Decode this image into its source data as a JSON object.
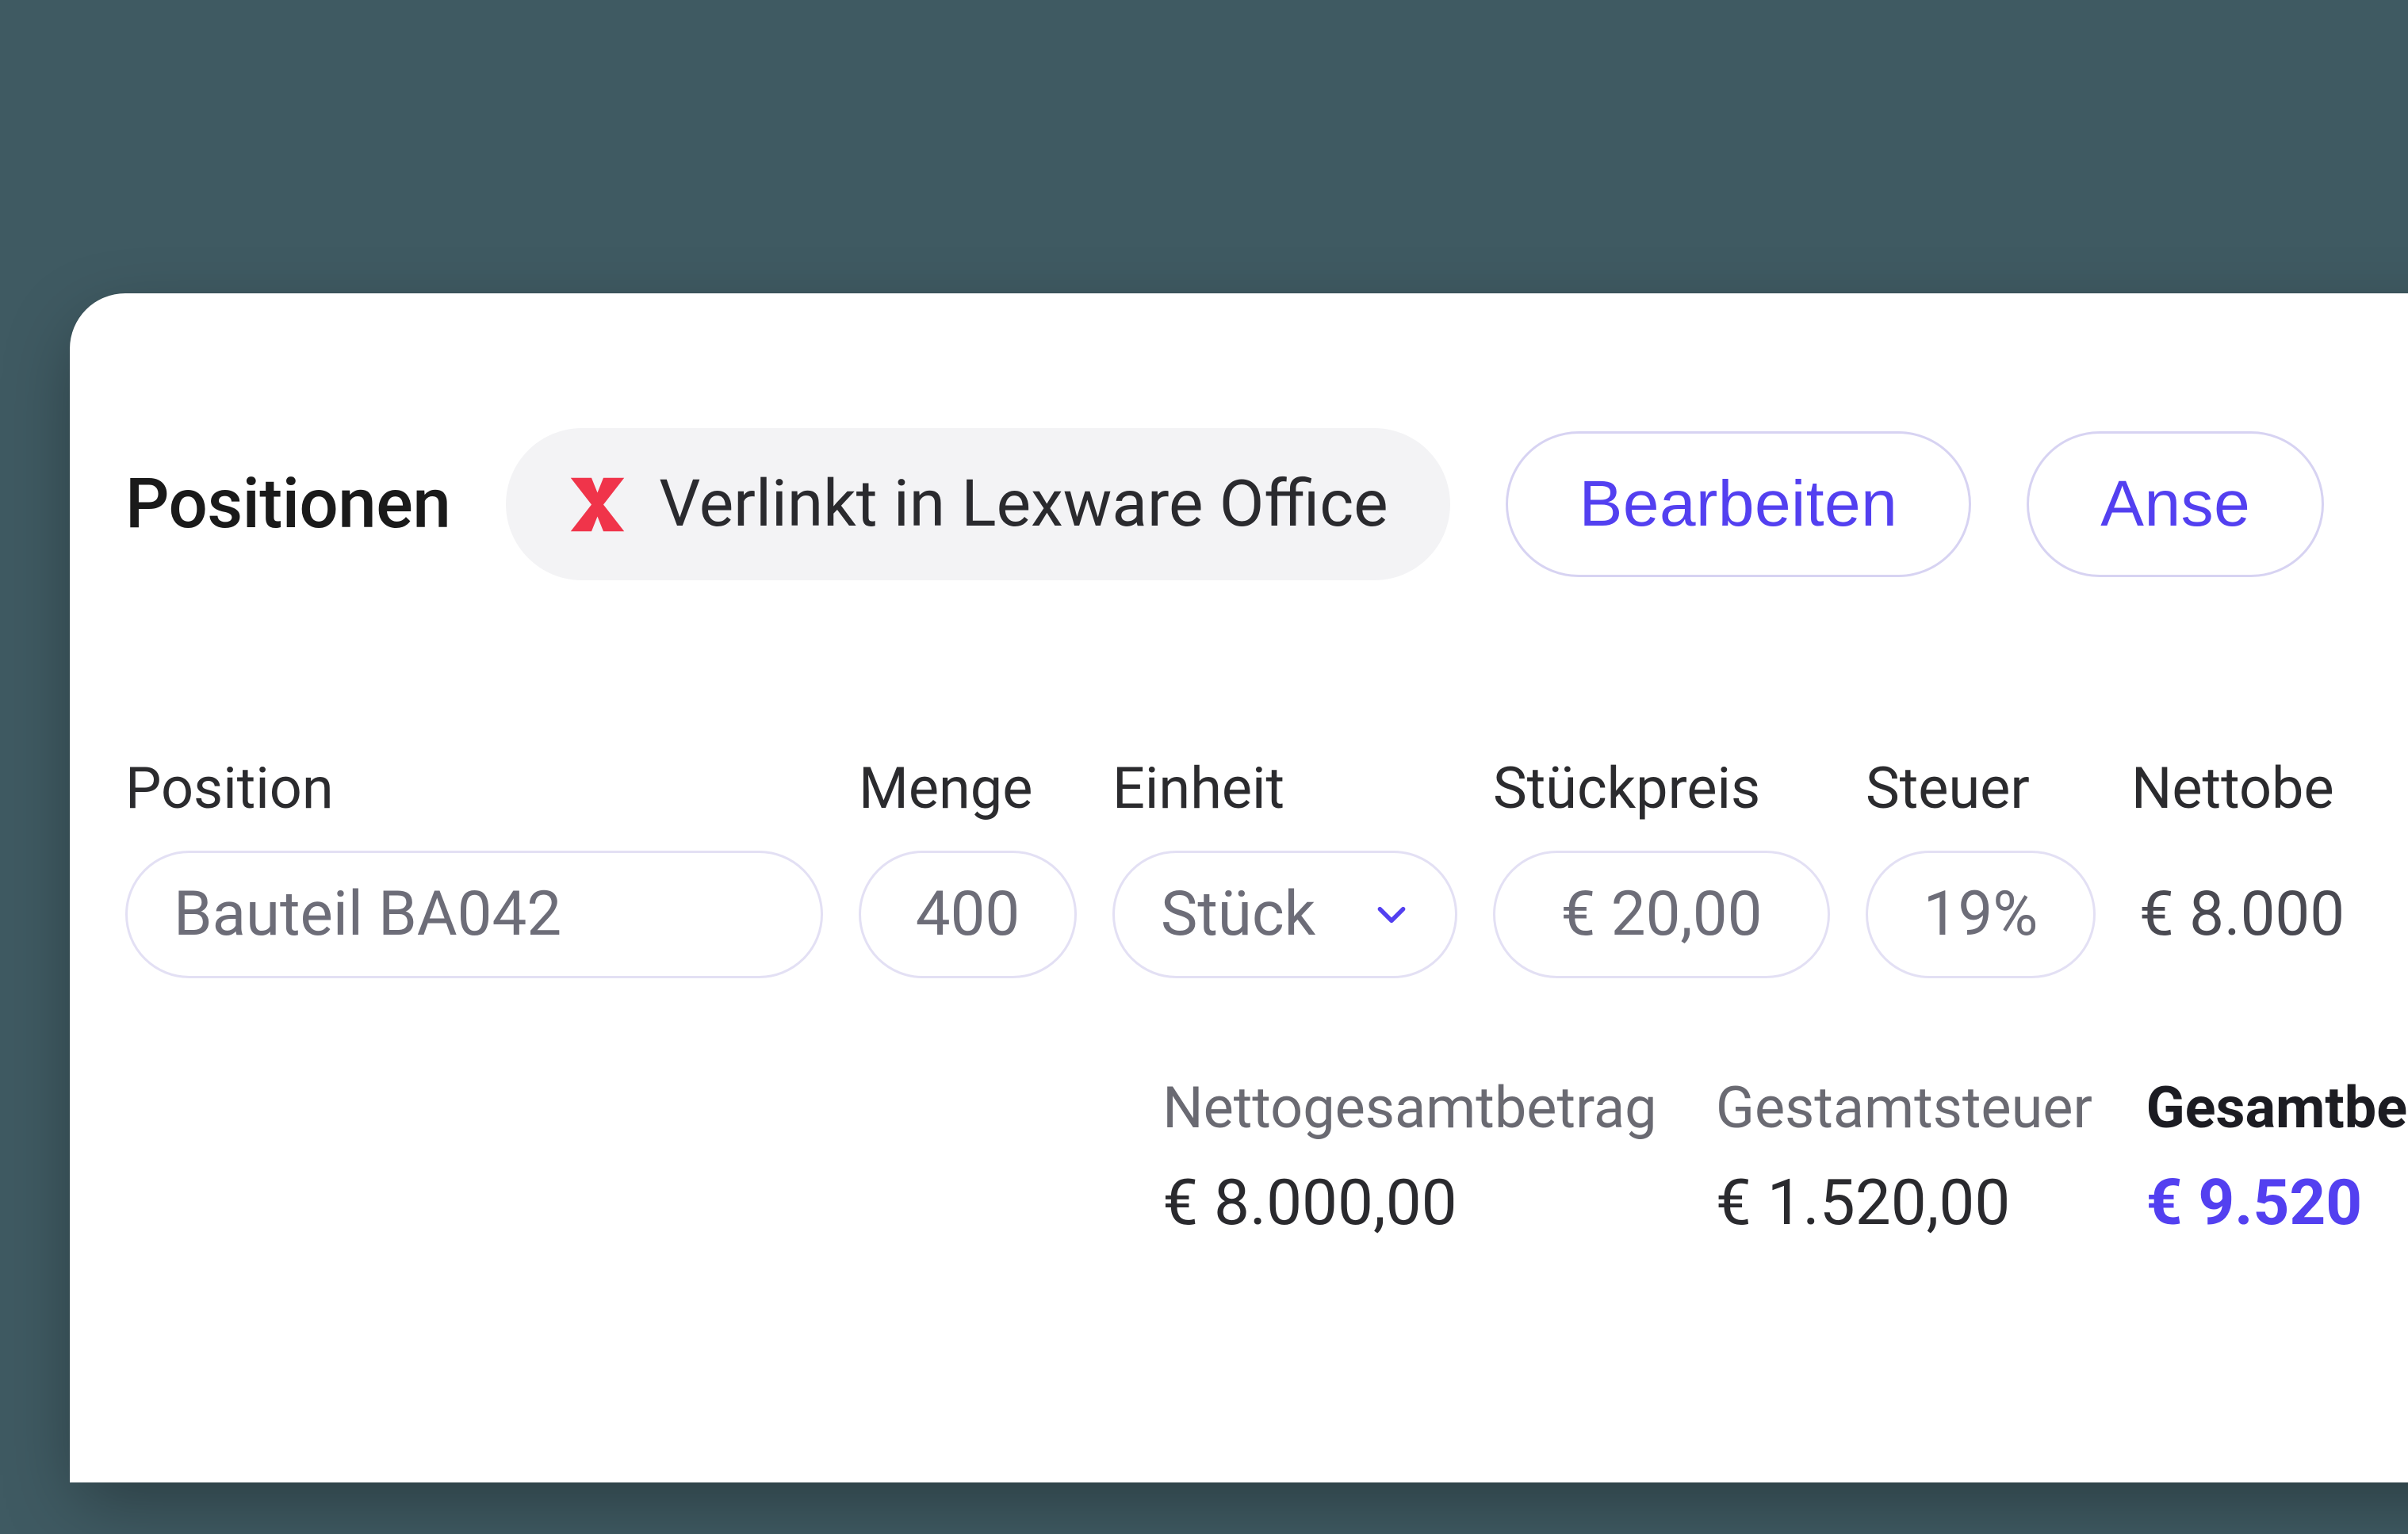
{
  "header": {
    "section_title": "Positionen",
    "linked_chip": "Verlinkt in Lexware Office",
    "edit_button": "Bearbeiten",
    "view_button": "Anse"
  },
  "columns": {
    "position": "Position",
    "menge": "Menge",
    "einheit": "Einheit",
    "stueckpreis": "Stückpreis",
    "steuer": "Steuer",
    "netto": "Nettobe"
  },
  "row": {
    "position": "Bauteil BA042",
    "menge": "400",
    "einheit": "Stück",
    "stueckpreis": "€ 20,00",
    "steuer": "19%",
    "netto": "€ 8.000"
  },
  "totals": {
    "net_label": "Nettogesamtbetrag",
    "net_value": "€ 8.000,00",
    "tax_label": "Gestamtsteuer",
    "tax_value": "€ 1.520,00",
    "grand_label": "Gesamtbe",
    "grand_value": "€ 9.520"
  },
  "colors": {
    "accent": "#5340f0",
    "brand_red": "#f0344a"
  }
}
